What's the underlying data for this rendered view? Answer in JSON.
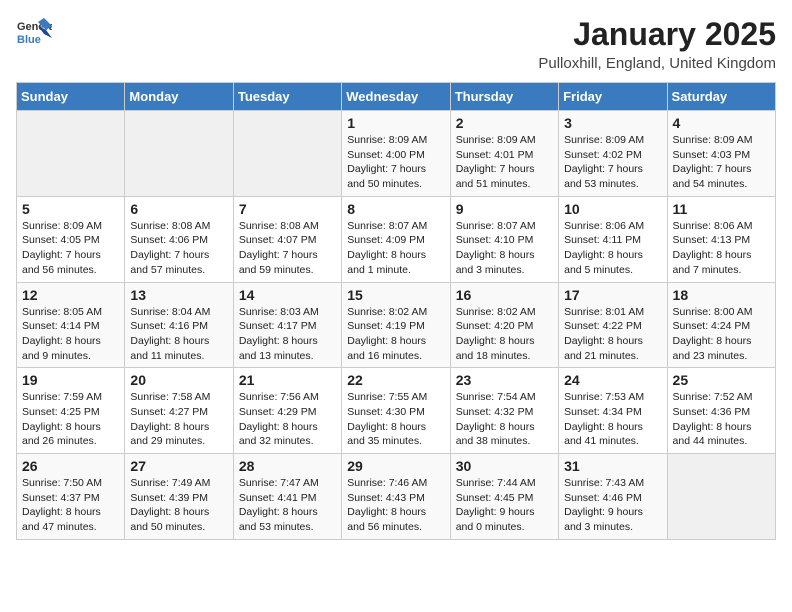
{
  "header": {
    "logo_general": "General",
    "logo_blue": "Blue",
    "month": "January 2025",
    "location": "Pulloxhill, England, United Kingdom"
  },
  "weekdays": [
    "Sunday",
    "Monday",
    "Tuesday",
    "Wednesday",
    "Thursday",
    "Friday",
    "Saturday"
  ],
  "weeks": [
    [
      {
        "day": "",
        "info": ""
      },
      {
        "day": "",
        "info": ""
      },
      {
        "day": "",
        "info": ""
      },
      {
        "day": "1",
        "info": "Sunrise: 8:09 AM\nSunset: 4:00 PM\nDaylight: 7 hours\nand 50 minutes."
      },
      {
        "day": "2",
        "info": "Sunrise: 8:09 AM\nSunset: 4:01 PM\nDaylight: 7 hours\nand 51 minutes."
      },
      {
        "day": "3",
        "info": "Sunrise: 8:09 AM\nSunset: 4:02 PM\nDaylight: 7 hours\nand 53 minutes."
      },
      {
        "day": "4",
        "info": "Sunrise: 8:09 AM\nSunset: 4:03 PM\nDaylight: 7 hours\nand 54 minutes."
      }
    ],
    [
      {
        "day": "5",
        "info": "Sunrise: 8:09 AM\nSunset: 4:05 PM\nDaylight: 7 hours\nand 56 minutes."
      },
      {
        "day": "6",
        "info": "Sunrise: 8:08 AM\nSunset: 4:06 PM\nDaylight: 7 hours\nand 57 minutes."
      },
      {
        "day": "7",
        "info": "Sunrise: 8:08 AM\nSunset: 4:07 PM\nDaylight: 7 hours\nand 59 minutes."
      },
      {
        "day": "8",
        "info": "Sunrise: 8:07 AM\nSunset: 4:09 PM\nDaylight: 8 hours\nand 1 minute."
      },
      {
        "day": "9",
        "info": "Sunrise: 8:07 AM\nSunset: 4:10 PM\nDaylight: 8 hours\nand 3 minutes."
      },
      {
        "day": "10",
        "info": "Sunrise: 8:06 AM\nSunset: 4:11 PM\nDaylight: 8 hours\nand 5 minutes."
      },
      {
        "day": "11",
        "info": "Sunrise: 8:06 AM\nSunset: 4:13 PM\nDaylight: 8 hours\nand 7 minutes."
      }
    ],
    [
      {
        "day": "12",
        "info": "Sunrise: 8:05 AM\nSunset: 4:14 PM\nDaylight: 8 hours\nand 9 minutes."
      },
      {
        "day": "13",
        "info": "Sunrise: 8:04 AM\nSunset: 4:16 PM\nDaylight: 8 hours\nand 11 minutes."
      },
      {
        "day": "14",
        "info": "Sunrise: 8:03 AM\nSunset: 4:17 PM\nDaylight: 8 hours\nand 13 minutes."
      },
      {
        "day": "15",
        "info": "Sunrise: 8:02 AM\nSunset: 4:19 PM\nDaylight: 8 hours\nand 16 minutes."
      },
      {
        "day": "16",
        "info": "Sunrise: 8:02 AM\nSunset: 4:20 PM\nDaylight: 8 hours\nand 18 minutes."
      },
      {
        "day": "17",
        "info": "Sunrise: 8:01 AM\nSunset: 4:22 PM\nDaylight: 8 hours\nand 21 minutes."
      },
      {
        "day": "18",
        "info": "Sunrise: 8:00 AM\nSunset: 4:24 PM\nDaylight: 8 hours\nand 23 minutes."
      }
    ],
    [
      {
        "day": "19",
        "info": "Sunrise: 7:59 AM\nSunset: 4:25 PM\nDaylight: 8 hours\nand 26 minutes."
      },
      {
        "day": "20",
        "info": "Sunrise: 7:58 AM\nSunset: 4:27 PM\nDaylight: 8 hours\nand 29 minutes."
      },
      {
        "day": "21",
        "info": "Sunrise: 7:56 AM\nSunset: 4:29 PM\nDaylight: 8 hours\nand 32 minutes."
      },
      {
        "day": "22",
        "info": "Sunrise: 7:55 AM\nSunset: 4:30 PM\nDaylight: 8 hours\nand 35 minutes."
      },
      {
        "day": "23",
        "info": "Sunrise: 7:54 AM\nSunset: 4:32 PM\nDaylight: 8 hours\nand 38 minutes."
      },
      {
        "day": "24",
        "info": "Sunrise: 7:53 AM\nSunset: 4:34 PM\nDaylight: 8 hours\nand 41 minutes."
      },
      {
        "day": "25",
        "info": "Sunrise: 7:52 AM\nSunset: 4:36 PM\nDaylight: 8 hours\nand 44 minutes."
      }
    ],
    [
      {
        "day": "26",
        "info": "Sunrise: 7:50 AM\nSunset: 4:37 PM\nDaylight: 8 hours\nand 47 minutes."
      },
      {
        "day": "27",
        "info": "Sunrise: 7:49 AM\nSunset: 4:39 PM\nDaylight: 8 hours\nand 50 minutes."
      },
      {
        "day": "28",
        "info": "Sunrise: 7:47 AM\nSunset: 4:41 PM\nDaylight: 8 hours\nand 53 minutes."
      },
      {
        "day": "29",
        "info": "Sunrise: 7:46 AM\nSunset: 4:43 PM\nDaylight: 8 hours\nand 56 minutes."
      },
      {
        "day": "30",
        "info": "Sunrise: 7:44 AM\nSunset: 4:45 PM\nDaylight: 9 hours\nand 0 minutes."
      },
      {
        "day": "31",
        "info": "Sunrise: 7:43 AM\nSunset: 4:46 PM\nDaylight: 9 hours\nand 3 minutes."
      },
      {
        "day": "",
        "info": ""
      }
    ]
  ]
}
